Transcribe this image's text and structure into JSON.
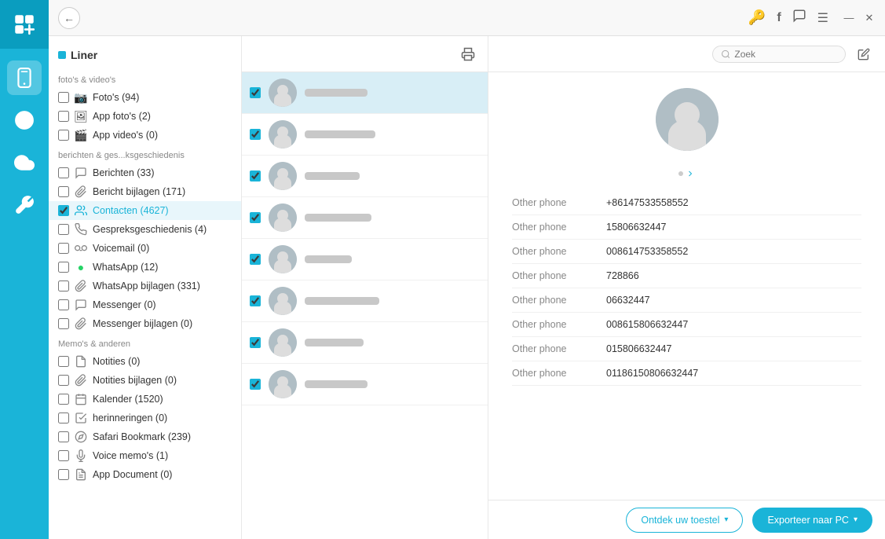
{
  "app": {
    "title": "Liner",
    "back_button_label": "←"
  },
  "sidebar": {
    "header": "Liner",
    "sections": [
      {
        "label": "foto's & video's",
        "items": [
          {
            "id": "fotos",
            "icon": "📷",
            "label": "Foto's (94)",
            "checked": false
          },
          {
            "id": "app-fotos",
            "icon": "🖼",
            "label": "App foto's (2)",
            "checked": false
          },
          {
            "id": "app-videos",
            "icon": "🎬",
            "label": "App video's (0)",
            "checked": false
          }
        ]
      },
      {
        "label": "berichten & ges...ksgeschiedenis",
        "items": [
          {
            "id": "berichten",
            "icon": "💬",
            "label": "Berichten (33)",
            "checked": false
          },
          {
            "id": "bericht-bijlagen",
            "icon": "📎",
            "label": "Bericht bijlagen (171)",
            "checked": false
          },
          {
            "id": "contacten",
            "icon": "👥",
            "label": "Contacten (4627)",
            "checked": true,
            "active": true
          },
          {
            "id": "gespreksgeschiedenis",
            "icon": "📞",
            "label": "Gespreksgeschiedenis (4)",
            "checked": false
          },
          {
            "id": "voicemail",
            "icon": "📢",
            "label": "Voicemail (0)",
            "checked": false
          },
          {
            "id": "whatsapp",
            "icon": "💚",
            "label": "WhatsApp (12)",
            "checked": false
          },
          {
            "id": "whatsapp-bijlagen",
            "icon": "📎",
            "label": "WhatsApp bijlagen (331)",
            "checked": false
          },
          {
            "id": "messenger",
            "icon": "💬",
            "label": "Messenger (0)",
            "checked": false
          },
          {
            "id": "messenger-bijlagen",
            "icon": "📎",
            "label": "Messenger bijlagen (0)",
            "checked": false
          }
        ]
      },
      {
        "label": "Memo's & anderen",
        "items": [
          {
            "id": "notities",
            "icon": "📝",
            "label": "Notities (0)",
            "checked": false
          },
          {
            "id": "notities-bijlagen",
            "icon": "📎",
            "label": "Notities bijlagen (0)",
            "checked": false
          },
          {
            "id": "kalender",
            "icon": "📅",
            "label": "Kalender (1520)",
            "checked": false
          },
          {
            "id": "herinneringen",
            "icon": "✅",
            "label": "herinneringen (0)",
            "checked": false
          },
          {
            "id": "safari",
            "icon": "🔖",
            "label": "Safari Bookmark (239)",
            "checked": false
          },
          {
            "id": "voice-memos",
            "icon": "🎙",
            "label": "Voice memo's (1)",
            "checked": false
          },
          {
            "id": "app-document",
            "icon": "📄",
            "label": "App Document (0)",
            "checked": false
          }
        ]
      }
    ]
  },
  "contact_list": {
    "search_placeholder": "Zoek",
    "contacts": [
      {
        "id": 1,
        "selected": true,
        "name_width": 80
      },
      {
        "id": 2,
        "selected": false,
        "name_width": 90
      },
      {
        "id": 3,
        "selected": false,
        "name_width": 70
      },
      {
        "id": 4,
        "selected": false,
        "name_width": 85
      },
      {
        "id": 5,
        "selected": false,
        "name_width": 60
      },
      {
        "id": 6,
        "selected": false,
        "name_width": 95
      },
      {
        "id": 7,
        "selected": false,
        "name_width": 75
      },
      {
        "id": 8,
        "selected": false,
        "name_width": 80
      }
    ]
  },
  "detail": {
    "search_placeholder": "Zoek",
    "phone_entries": [
      {
        "label": "Other phone",
        "value": "+86147533558552"
      },
      {
        "label": "Other phone",
        "value": "15806632447"
      },
      {
        "label": "Other phone",
        "value": "008614753358552"
      },
      {
        "label": "Other phone",
        "value": "728866"
      },
      {
        "label": "Other phone",
        "value": "06632447"
      },
      {
        "label": "Other phone",
        "value": "008615806632447"
      },
      {
        "label": "Other phone",
        "value": "015806632447"
      },
      {
        "label": "Other phone",
        "value": "01186150806632447"
      }
    ]
  },
  "bottom_bar": {
    "discover_label": "Ontdek uw toestel",
    "export_label": "Exporteer naar PC"
  },
  "title_bar": {
    "icons": [
      {
        "id": "key",
        "symbol": "🔑",
        "active": true
      },
      {
        "id": "facebook",
        "symbol": "f",
        "active": false
      },
      {
        "id": "chat",
        "symbol": "💬",
        "active": false
      },
      {
        "id": "menu",
        "symbol": "☰",
        "active": false
      }
    ]
  }
}
